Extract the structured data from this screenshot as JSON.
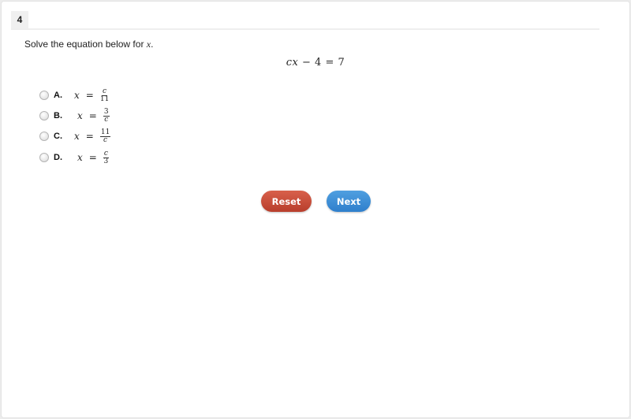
{
  "question": {
    "number": "4",
    "prompt_text": "Solve the equation below for ",
    "prompt_var": "x",
    "prompt_end": ".",
    "equation": {
      "lhs_var": "cx",
      "op": "−",
      "const": "4",
      "eq": "=",
      "rhs": "7"
    }
  },
  "choices": [
    {
      "letter": "A.",
      "var": "x",
      "eq": "=",
      "numerator": "c",
      "denominator": "11",
      "selected": false
    },
    {
      "letter": "B.",
      "var": "x",
      "eq": "=",
      "numerator": "3",
      "denominator": "c",
      "selected": false
    },
    {
      "letter": "C.",
      "var": "x",
      "eq": "=",
      "numerator": "11",
      "denominator": "c",
      "selected": false
    },
    {
      "letter": "D.",
      "var": "x",
      "eq": "=",
      "numerator": "c",
      "denominator": "3",
      "selected": false
    }
  ],
  "buttons": {
    "reset": "Reset",
    "next": "Next"
  },
  "colors": {
    "reset": "#c94a37",
    "next": "#3d8fd8"
  }
}
